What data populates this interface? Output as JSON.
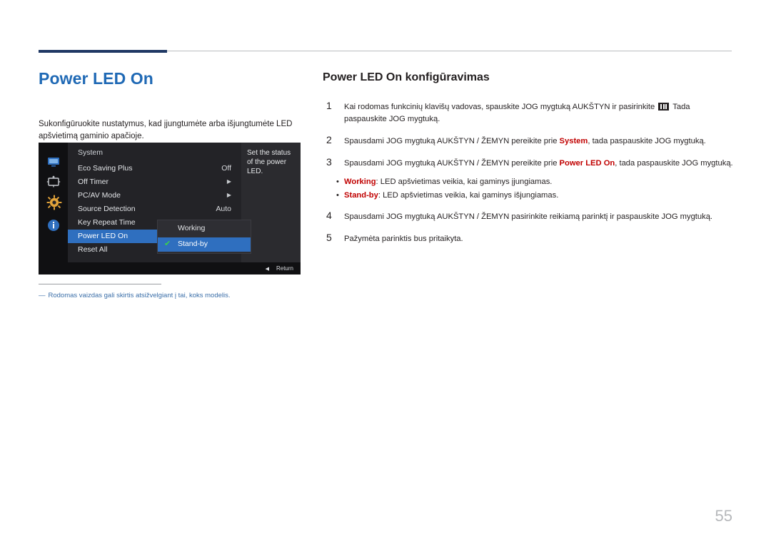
{
  "document": {
    "page_number": "55",
    "left": {
      "title": "Power LED On",
      "intro": "Sukonfigūruokite nustatymus, kad įjungtumėte arba išjungtumėte LED apšvietimą gaminio apačioje.",
      "footnote_dash": "―",
      "footnote": "Rodomas vaizdas gali skirtis atsižvelgiant į tai, koks modelis."
    },
    "osd": {
      "menu_title": "System",
      "icons": [
        "monitor-icon",
        "picture-size-icon",
        "gear-icon",
        "info-icon"
      ],
      "rows": [
        {
          "label": "Eco Saving Plus",
          "value": "Off",
          "arrow": "",
          "selected": false
        },
        {
          "label": "Off Timer",
          "value": "",
          "arrow": "▶",
          "selected": false
        },
        {
          "label": "PC/AV Mode",
          "value": "",
          "arrow": "▶",
          "selected": false
        },
        {
          "label": "Source Detection",
          "value": "Auto",
          "arrow": "",
          "selected": false
        },
        {
          "label": "Key Repeat Time",
          "value": "",
          "arrow": "",
          "selected": false
        },
        {
          "label": "Power LED On",
          "value": "",
          "arrow": "",
          "selected": true
        },
        {
          "label": "Reset All",
          "value": "",
          "arrow": "",
          "selected": false
        }
      ],
      "submenu": [
        {
          "label": "Working",
          "checked": false,
          "selected": false
        },
        {
          "label": "Stand-by",
          "checked": true,
          "selected": true
        }
      ],
      "hint": "Set the status of the power LED.",
      "footer_return": "Return",
      "footer_left_arrow": "◀",
      "check_glyph": "✔"
    },
    "right": {
      "section_title": "Power LED On konfigūravimas",
      "steps": [
        {
          "num": "1",
          "text_parts": [
            {
              "t": "Kai rodomas funkcinių klavišų vadovas, spauskite JOG mygtuką AUKŠTYN ir pasirinkite ",
              "style": "normal"
            },
            {
              "t": "MENU-ICON",
              "style": "icon"
            },
            {
              "t": " Tada paspauskite JOG mygtuką.",
              "style": "normal"
            }
          ]
        },
        {
          "num": "2",
          "text_parts": [
            {
              "t": "Spausdami JOG mygtuką AUKŠTYN / ŽEMYN pereikite prie ",
              "style": "normal"
            },
            {
              "t": "System",
              "style": "bold-red"
            },
            {
              "t": ", tada paspauskite JOG mygtuką.",
              "style": "normal"
            }
          ]
        },
        {
          "num": "3",
          "text_parts": [
            {
              "t": "Spausdami JOG mygtuką AUKŠTYN / ŽEMYN pereikite prie ",
              "style": "normal"
            },
            {
              "t": "Power LED On",
              "style": "bold-red"
            },
            {
              "t": ", tada paspauskite JOG mygtuką.",
              "style": "normal"
            }
          ]
        },
        {
          "num": "4",
          "text_parts": [
            {
              "t": "Spausdami JOG mygtuką AUKŠTYN / ŽEMYN pasirinkite reikiamą parinktį ir paspauskite JOG mygtuką.",
              "style": "normal"
            }
          ]
        },
        {
          "num": "5",
          "text_parts": [
            {
              "t": "Pažymėta parinktis bus pritaikyta.",
              "style": "normal"
            }
          ]
        }
      ],
      "bullets": [
        {
          "bullet": "•",
          "keyword": "Working",
          "rest": ": LED apšvietimas veikia, kai gaminys įjungiamas."
        },
        {
          "bullet": "•",
          "keyword": "Stand-by",
          "rest": ": LED apšvietimas veikia, kai gaminys išjungiamas."
        }
      ]
    },
    "colors": {
      "title_blue": "#1f69b5",
      "rule_dark": "#1f3864",
      "keyword_red": "#c00000",
      "footnote_blue": "#3a6ea8",
      "osd_highlight": "#2f6fbf",
      "osd_check_green": "#3bd14a"
    }
  }
}
